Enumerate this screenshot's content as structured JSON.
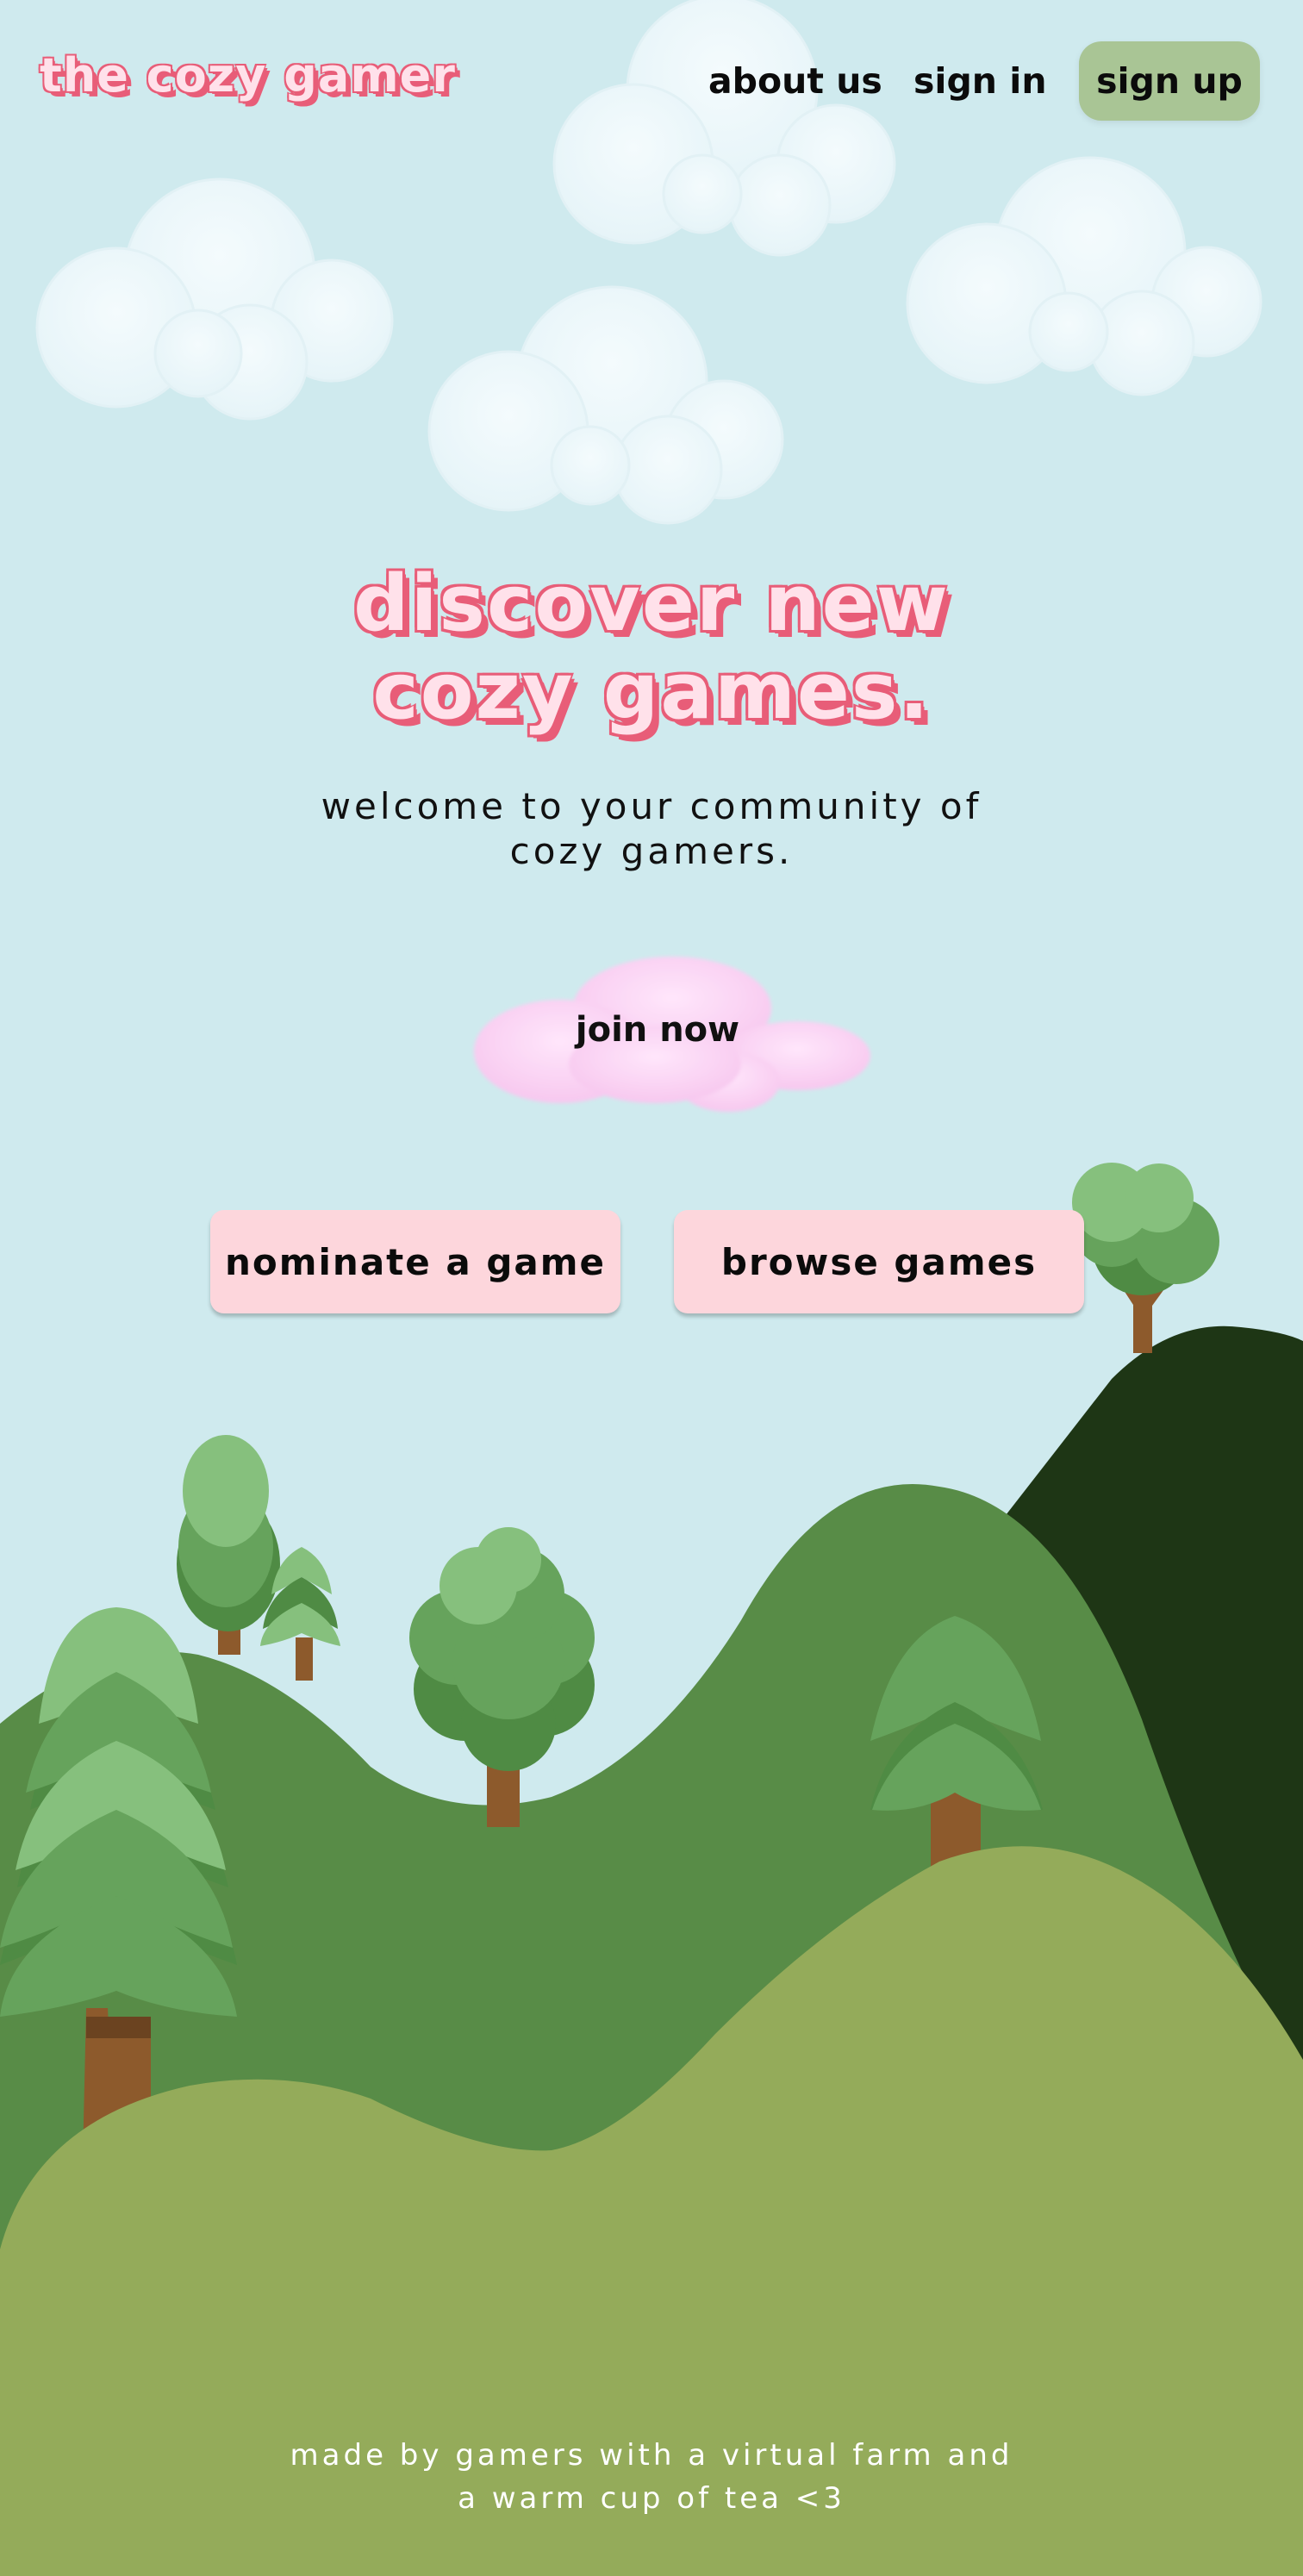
{
  "nav": {
    "logo": "the cozy gamer",
    "about": "about us",
    "signin": "sign in",
    "signup": "sign up"
  },
  "hero": {
    "title_line1": "discover new",
    "title_line2": "cozy games.",
    "subtitle_line1": "welcome to your community of",
    "subtitle_line2": "cozy gamers.",
    "join": "join now"
  },
  "actions": {
    "nominate": "nominate a game",
    "browse": "browse games"
  },
  "footer": {
    "line1": "made by gamers with a virtual farm and",
    "line2": "a warm cup of tea <3"
  },
  "colors": {
    "sky": "#cfeaee",
    "accent_pink": "#e85d78",
    "button_pink": "#fdd6dc",
    "signup_green": "#a9c595",
    "hill_front": "#94ab5a",
    "hill_mid": "#588c47",
    "hill_back": "#1e3615"
  }
}
